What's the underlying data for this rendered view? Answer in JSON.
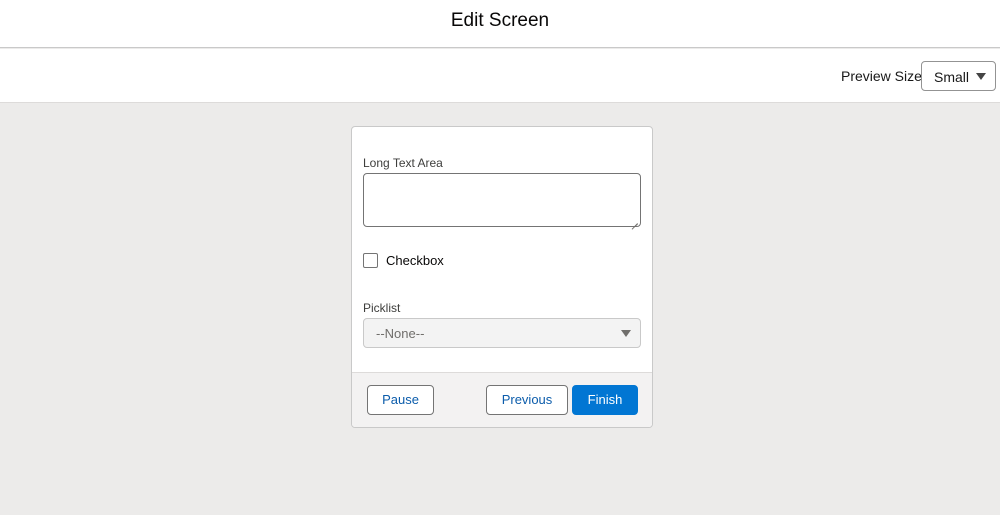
{
  "header": {
    "title": "Edit Screen"
  },
  "toolbar": {
    "preview_size_label": "Preview Size",
    "preview_size_value": "Small",
    "caret_icon": "chevron-down-icon"
  },
  "form": {
    "long_text_area": {
      "label": "Long Text Area",
      "value": ""
    },
    "checkbox": {
      "label": "Checkbox",
      "checked": false
    },
    "picklist": {
      "label": "Picklist",
      "value": "--None--"
    }
  },
  "footer": {
    "pause_label": "Pause",
    "previous_label": "Previous",
    "finish_label": "Finish"
  },
  "colors": {
    "brand": "#0176d3",
    "neutral_text": "#0b5cab",
    "canvas": "#ecebea"
  }
}
